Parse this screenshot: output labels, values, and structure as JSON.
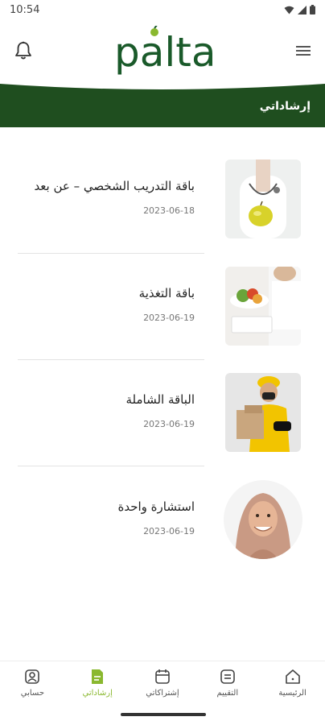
{
  "status_bar": {
    "time": "10:54"
  },
  "header": {
    "logo_text": "palta"
  },
  "banner": {
    "title": "إرشاداتي",
    "color": "#1f4e1f"
  },
  "items": [
    {
      "title": "باقة التدريب الشخصي – عن بعد",
      "date": "2023-06-18",
      "image": "doctor-with-apple"
    },
    {
      "title": "باقة التغذية",
      "date": "2023-06-19",
      "image": "nutrition-consult"
    },
    {
      "title": "الباقة الشاملة",
      "date": "2023-06-19",
      "image": "delivery-person"
    },
    {
      "title": "استشارة واحدة",
      "date": "2023-06-19",
      "image": "smiling-woman"
    }
  ],
  "bottom_nav": [
    {
      "label": "الرئيسية",
      "icon": "home-icon",
      "active": false
    },
    {
      "label": "التقييم",
      "icon": "assessment-icon",
      "active": false
    },
    {
      "label": "إشتراكاتي",
      "icon": "calendar-icon",
      "active": false
    },
    {
      "label": "إرشاداتي",
      "icon": "document-icon",
      "active": true
    },
    {
      "label": "حسابي",
      "icon": "profile-icon",
      "active": false
    }
  ],
  "colors": {
    "primary_green": "#1f4e1f",
    "accent_green": "#8ab82f",
    "logo_green": "#1a5a2a"
  }
}
